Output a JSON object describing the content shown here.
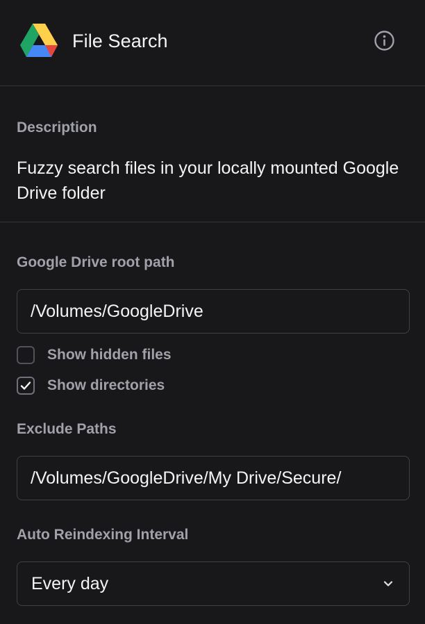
{
  "header": {
    "app_icon": "google-drive-icon",
    "title": "File Search",
    "info_icon": "info-icon"
  },
  "description": {
    "label": "Description",
    "text": "Fuzzy search files in your locally mounted Google Drive folder"
  },
  "settings": {
    "root_path": {
      "label": "Google Drive root path",
      "value": "/Volumes/GoogleDrive"
    },
    "show_hidden_files": {
      "label": "Show hidden files",
      "checked": false
    },
    "show_directories": {
      "label": "Show directories",
      "checked": true
    },
    "exclude_paths": {
      "label": "Exclude Paths",
      "value": "/Volumes/GoogleDrive/My Drive/Secure/"
    },
    "reindex_interval": {
      "label": "Auto Reindexing Interval",
      "selected": "Every day",
      "icon": "chevron-down-icon"
    }
  },
  "colors": {
    "background": "#18181b",
    "divider": "#34343a",
    "border": "#3f3f46",
    "label": "#a1a1aa",
    "text": "#f4f4f5",
    "drive_green": "#1fa463",
    "drive_yellow": "#ffd04b",
    "drive_blue": "#4688f4",
    "drive_red": "#e8453c"
  }
}
